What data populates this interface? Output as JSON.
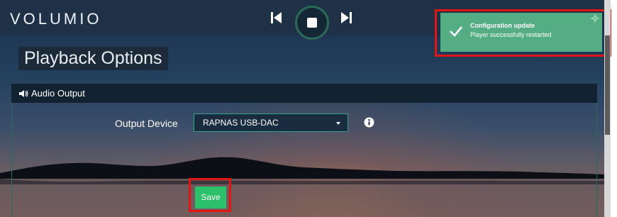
{
  "header": {
    "logo": "VOLUMIO"
  },
  "transport": {
    "prev_icon": "skip-previous-icon",
    "stop_icon": "stop-icon",
    "next_icon": "skip-next-icon"
  },
  "page": {
    "title": "Playback Options"
  },
  "panel": {
    "icon": "speaker-icon",
    "title": "Audio Output"
  },
  "form": {
    "output_device_label": "Output Device",
    "output_device_value": "RAPNAS USB-DAC",
    "info_icon": "info-icon",
    "save_label": "Save"
  },
  "toast": {
    "icon": "checkmark-icon",
    "title": "Configuration update",
    "message": "Player successfully restarted",
    "gear_icon": "gear-icon"
  },
  "colors": {
    "accent": "#2dc06a",
    "toast": "#55ad84",
    "highlight": "#e31414",
    "topbar": "#1f3147"
  }
}
